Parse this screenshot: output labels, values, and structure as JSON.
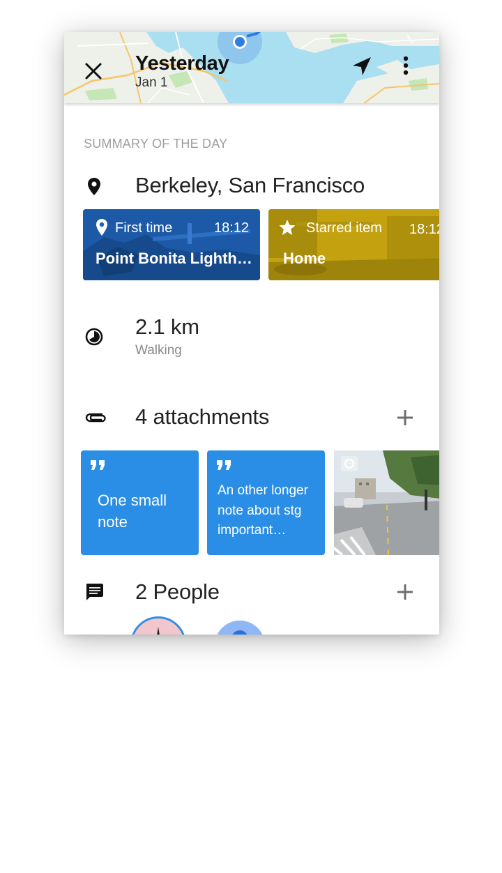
{
  "header": {
    "title": "Yesterday",
    "date": "Jan 1",
    "map_water_color": "#aadff2"
  },
  "summary": {
    "section_label": "SUMMARY OF THE DAY",
    "location": {
      "icon": "location-pin-icon",
      "title": "Berkeley, San Francisco"
    },
    "places": [
      {
        "tag": "First time",
        "icon": "location-pin-icon",
        "time": "18:12",
        "name": "Point Bonita Ligh​th…",
        "color": "#1e63b4"
      },
      {
        "tag": "Starred item",
        "icon": "star-icon",
        "time": "18:12",
        "name": "Home",
        "color": "#b8980e"
      }
    ],
    "distance": {
      "icon": "pie-timer-icon",
      "value": "2.1 km",
      "mode": "Walking"
    }
  },
  "attachments": {
    "icon": "paperclip-icon",
    "title": "4 attachments",
    "notes": [
      {
        "text": "One small note"
      },
      {
        "text": "An other longer note about stg important…"
      }
    ],
    "note_color": "#2b8ee6"
  },
  "people": {
    "icon": "chat-icon",
    "title": "2 People"
  }
}
